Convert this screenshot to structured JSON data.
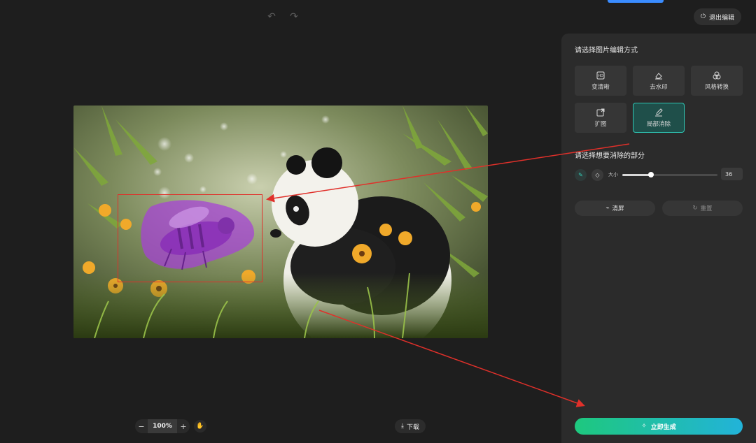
{
  "top": {
    "undo_icon": "undo-icon",
    "redo_icon": "redo-icon",
    "exit_label": "退出编辑"
  },
  "canvas": {
    "image_alt": "panda with bee among flowers"
  },
  "bottom": {
    "zoom_minus": "−",
    "zoom_value": "100%",
    "zoom_plus": "+",
    "download_label": "下载"
  },
  "panel": {
    "title": "请选择图片编辑方式",
    "tools": [
      {
        "label": "变清晰",
        "icon": "hd-icon"
      },
      {
        "label": "去水印",
        "icon": "eraser-icon"
      },
      {
        "label": "风格转换",
        "icon": "style-icon"
      },
      {
        "label": "扩图",
        "icon": "expand-icon"
      },
      {
        "label": "局部消除",
        "icon": "brush-erase-icon"
      }
    ],
    "sub_title": "请选择想要消除的部分",
    "size_label": "大小",
    "size_value": "36",
    "size_fraction": 0.3,
    "clear_label": "清屏",
    "reset_label": "重置",
    "generate_label": "立即生成"
  },
  "colors": {
    "accent": "#2fc6b4",
    "annotation": "#e0302a",
    "gradient_start": "#1ec87e",
    "gradient_end": "#22b3d9"
  }
}
